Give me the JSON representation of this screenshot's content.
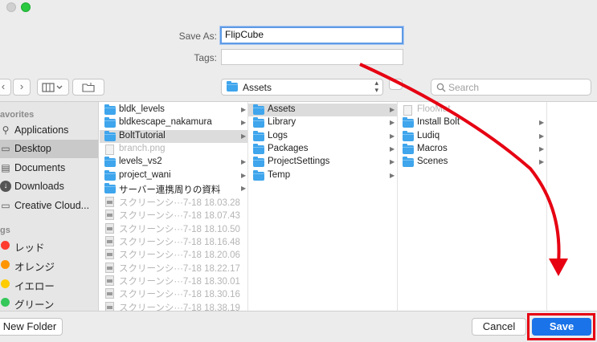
{
  "dialog": {
    "save_as_label": "Save As:",
    "save_as_value": "FlipCube",
    "tags_label": "Tags:",
    "tags_value": ""
  },
  "toolbar": {
    "back_icon": "chevron-left-icon",
    "forward_icon": "chevron-right-icon",
    "view_icon": "column-view-icon",
    "new_folder_icon": "new-folder-icon",
    "location": "Assets",
    "search_placeholder": "Search"
  },
  "sidebar": {
    "favorites_header": "avorites",
    "favorites": [
      {
        "label": "Applications",
        "icon": "applications-icon"
      },
      {
        "label": "Desktop",
        "icon": "desktop-icon",
        "selected": true
      },
      {
        "label": "Documents",
        "icon": "documents-icon"
      },
      {
        "label": "Downloads",
        "icon": "downloads-icon"
      },
      {
        "label": "Creative Cloud...",
        "icon": "folder-icon"
      }
    ],
    "tags_header": "gs",
    "tags": [
      {
        "label": "レッド",
        "color": "#ff3b30"
      },
      {
        "label": "オレンジ",
        "color": "#ff9500"
      },
      {
        "label": "イエロー",
        "color": "#ffcc00"
      },
      {
        "label": "グリーン",
        "color": "#34c759"
      }
    ]
  },
  "column1": [
    {
      "name": "bldk_levels",
      "type": "folder",
      "arrow": true
    },
    {
      "name": "bldkescape_nakamura",
      "type": "folder",
      "arrow": true
    },
    {
      "name": "BoltTutorial",
      "type": "folder",
      "arrow": true,
      "selected": true
    },
    {
      "name": "branch.png",
      "type": "file",
      "gray": true
    },
    {
      "name": "levels_vs2",
      "type": "folder",
      "arrow": true
    },
    {
      "name": "project_wani",
      "type": "folder",
      "arrow": true
    },
    {
      "name": "サーバー連携周りの資料",
      "type": "folder",
      "arrow": true
    },
    {
      "name": "スクリーンシ···7-18 18.03.28",
      "type": "image",
      "gray": true
    },
    {
      "name": "スクリーンシ···7-18 18.07.43",
      "type": "image",
      "gray": true
    },
    {
      "name": "スクリーンシ···7-18 18.10.50",
      "type": "image",
      "gray": true
    },
    {
      "name": "スクリーンシ···7-18 18.16.48",
      "type": "image",
      "gray": true
    },
    {
      "name": "スクリーンシ···7-18 18.20.06",
      "type": "image",
      "gray": true
    },
    {
      "name": "スクリーンシ···7-18 18.22.17",
      "type": "image",
      "gray": true
    },
    {
      "name": "スクリーンシ···7-18 18.30.01",
      "type": "image",
      "gray": true
    },
    {
      "name": "スクリーンシ···7-18 18.30.16",
      "type": "image",
      "gray": true
    },
    {
      "name": "スクリーンシ···7-18 18.38.19",
      "type": "image",
      "gray": true
    }
  ],
  "column2": [
    {
      "name": "Assets",
      "type": "folder",
      "arrow": true,
      "selected": true
    },
    {
      "name": "Library",
      "type": "folder",
      "arrow": true
    },
    {
      "name": "Logs",
      "type": "folder",
      "arrow": true
    },
    {
      "name": "Packages",
      "type": "folder",
      "arrow": true
    },
    {
      "name": "ProjectSettings",
      "type": "folder",
      "arrow": true
    },
    {
      "name": "Temp",
      "type": "folder",
      "arrow": true
    }
  ],
  "column3": [
    {
      "name": "FlooMat",
      "type": "file",
      "gray": true
    },
    {
      "name": "Install Bolt",
      "type": "folder",
      "arrow": true
    },
    {
      "name": "Ludiq",
      "type": "folder",
      "arrow": true
    },
    {
      "name": "Macros",
      "type": "folder",
      "arrow": true
    },
    {
      "name": "Scenes",
      "type": "folder",
      "arrow": true
    }
  ],
  "buttons": {
    "new_folder": "New Folder",
    "cancel": "Cancel",
    "save": "Save"
  },
  "colors": {
    "accent": "#1a73e8",
    "annotation": "#e60012",
    "folder": "#3fa5ec"
  }
}
